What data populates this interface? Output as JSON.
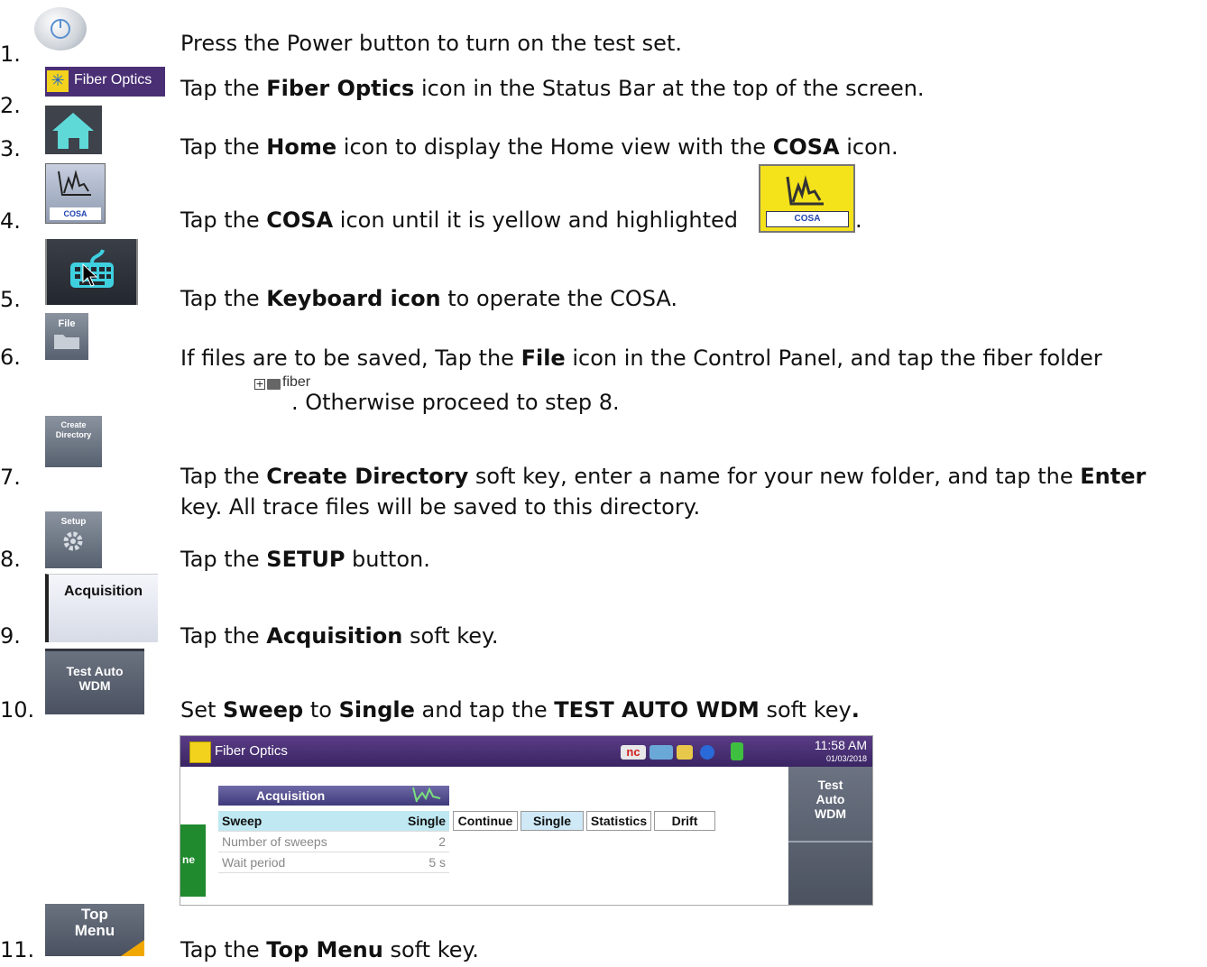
{
  "steps": [
    {
      "num": "1.",
      "pre": "Press the Power button to turn on the test set.",
      "bold1": "",
      "mid": "",
      "bold2": "",
      "post": ""
    },
    {
      "num": "2.",
      "pre": "Tap the ",
      "bold1": "Fiber Optics",
      "mid": " icon in the Status Bar at the top of the screen.",
      "bold2": "",
      "post": ""
    },
    {
      "num": "3.",
      "pre": "Tap the ",
      "bold1": "Home",
      "mid": " icon to display the Home view with the ",
      "bold2": "COSA",
      "post": " icon."
    },
    {
      "num": "4.",
      "pre": "Tap the ",
      "bold1": "COSA",
      "mid": " icon until it is yellow and highlighted",
      "bold2": "",
      "post": "."
    },
    {
      "num": "5.",
      "pre": "Tap the ",
      "bold1": "Keyboard icon",
      "mid": " to operate the COSA.",
      "bold2": "",
      "post": ""
    },
    {
      "num": "6.",
      "pre": "If files are to be saved, Tap the ",
      "bold1": "File",
      "mid": " icon in the Control Panel, and tap the fiber folder",
      "bold2": "",
      "post": ""
    },
    {
      "num": "7.",
      "pre": "Tap the ",
      "bold1": "Create Directory",
      "mid": " soft key, enter a name for your new folder, and tap the ",
      "bold2": "Enter",
      "post": ""
    },
    {
      "num": "8.",
      "pre": "Tap the ",
      "bold1": "SETUP",
      "mid": " button.",
      "bold2": "",
      "post": ""
    },
    {
      "num": "9.",
      "pre": "Tap the ",
      "bold1": "Acquisition",
      "mid": " soft key.",
      "bold2": "",
      "post": ""
    },
    {
      "num": "10.",
      "pre": "Set ",
      "bold1": "Sweep",
      "mid": " to ",
      "bold2": "Single",
      "post": " and tap the "
    },
    {
      "num": "11.",
      "pre": "Tap the ",
      "bold1": "Top Menu",
      "mid": " soft key.",
      "bold2": "",
      "post": ""
    }
  ],
  "step6_line2": ". Otherwise proceed to step 8.",
  "step7_line2": "key. All trace files will be saved to this directory.",
  "step10_bold3": "TEST AUTO WDM",
  "step10_tail": " soft key",
  "step10_dot": ".",
  "icons": {
    "fiber_label": "Fiber Optics",
    "cosa_label": "COSA",
    "file_label": "File",
    "create_dir_label": "Create Directory",
    "setup_label": "Setup",
    "acquisition_label": "Acquisition",
    "test_auto_wdm": "Test Auto WDM",
    "top_menu": "Top Menu",
    "folder_text": "fiber"
  },
  "screenshot": {
    "title": "Fiber Optics",
    "time": "11:58 AM",
    "date": "01/03/2018",
    "nc": "nc",
    "panel_header": "Acquisition",
    "rows": [
      {
        "key": "Sweep",
        "value": "Single"
      },
      {
        "key": "Number of sweeps",
        "value": "2"
      },
      {
        "key": "Wait period",
        "value": "5 s"
      }
    ],
    "options": [
      "Continue",
      "Single",
      "Statistics",
      "Drift"
    ],
    "softkey": "Test Auto WDM",
    "left_tab": "ne"
  },
  "colors": {
    "accent_purple": "#4a2f75",
    "cosa_yellow": "#f4e21a",
    "green": "#1f8a2e",
    "selected_option": "#cfe9f7"
  }
}
